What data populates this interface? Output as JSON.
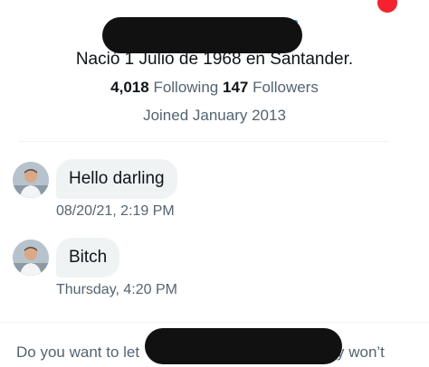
{
  "profile": {
    "bio": "Nació 1 Julio de 1968 en Santander.",
    "following_count": "4,018",
    "following_label": "Following",
    "followers_count": "147",
    "followers_label": "Followers",
    "joined": "Joined January 2013"
  },
  "messages": [
    {
      "text": "Hello darling",
      "timestamp": "08/20/21, 2:19 PM"
    },
    {
      "text": "Bitch",
      "timestamp": "Thursday, 4:20 PM"
    }
  ],
  "request_prompt": {
    "text_start": "Do you want to let",
    "text_end": "y won’t"
  },
  "colors": {
    "bubble": "#eff3f4",
    "secondary_text": "#536471",
    "primary_text": "#0f1419",
    "notification": "#f4212e",
    "redaction": "#111111"
  },
  "icons": {
    "avatar": "user-avatar",
    "notification": "notification-dot"
  }
}
